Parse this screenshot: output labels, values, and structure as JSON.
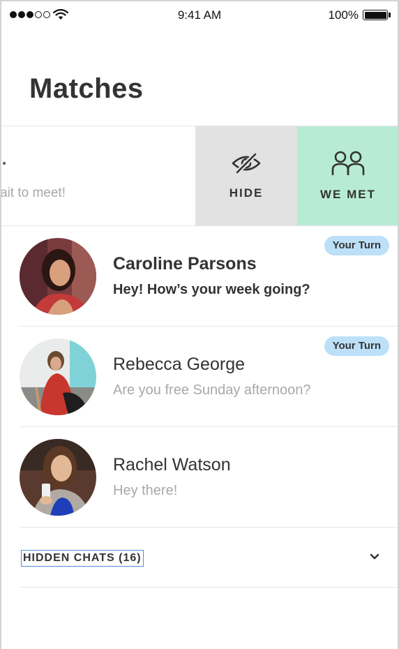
{
  "status_bar": {
    "time": "9:41 AM",
    "battery_percent": "100%",
    "signal_bars_filled": 3,
    "signal_bars_total": 5,
    "battery_level": 1.0
  },
  "title": "Matches",
  "swiped_row": {
    "message_preview": "ait to meet!",
    "actions": [
      {
        "label": "HIDE",
        "icon": "eye-slash-icon",
        "color": "#e2e2e2"
      },
      {
        "label": "WE MET",
        "icon": "two-people-icon",
        "color": "#b7ecd3"
      }
    ]
  },
  "matches": [
    {
      "name": "Caroline Parsons",
      "message": "Hey! How’s your week going?",
      "badge": "Your Turn",
      "unread": true
    },
    {
      "name": "Rebecca George",
      "message": "Are you free Sunday afternoon?",
      "badge": "Your Turn",
      "unread": false
    },
    {
      "name": "Rachel Watson",
      "message": "Hey there!",
      "badge": "",
      "unread": false
    }
  ],
  "hidden_chats": {
    "label": "HIDDEN CHATS (16)",
    "icon": "chevron-down-icon"
  },
  "colors": {
    "badge": "#bde0f9",
    "we_met": "#b7ecd3",
    "hide": "#e2e2e2",
    "focus_outline": "#4a90e2"
  }
}
